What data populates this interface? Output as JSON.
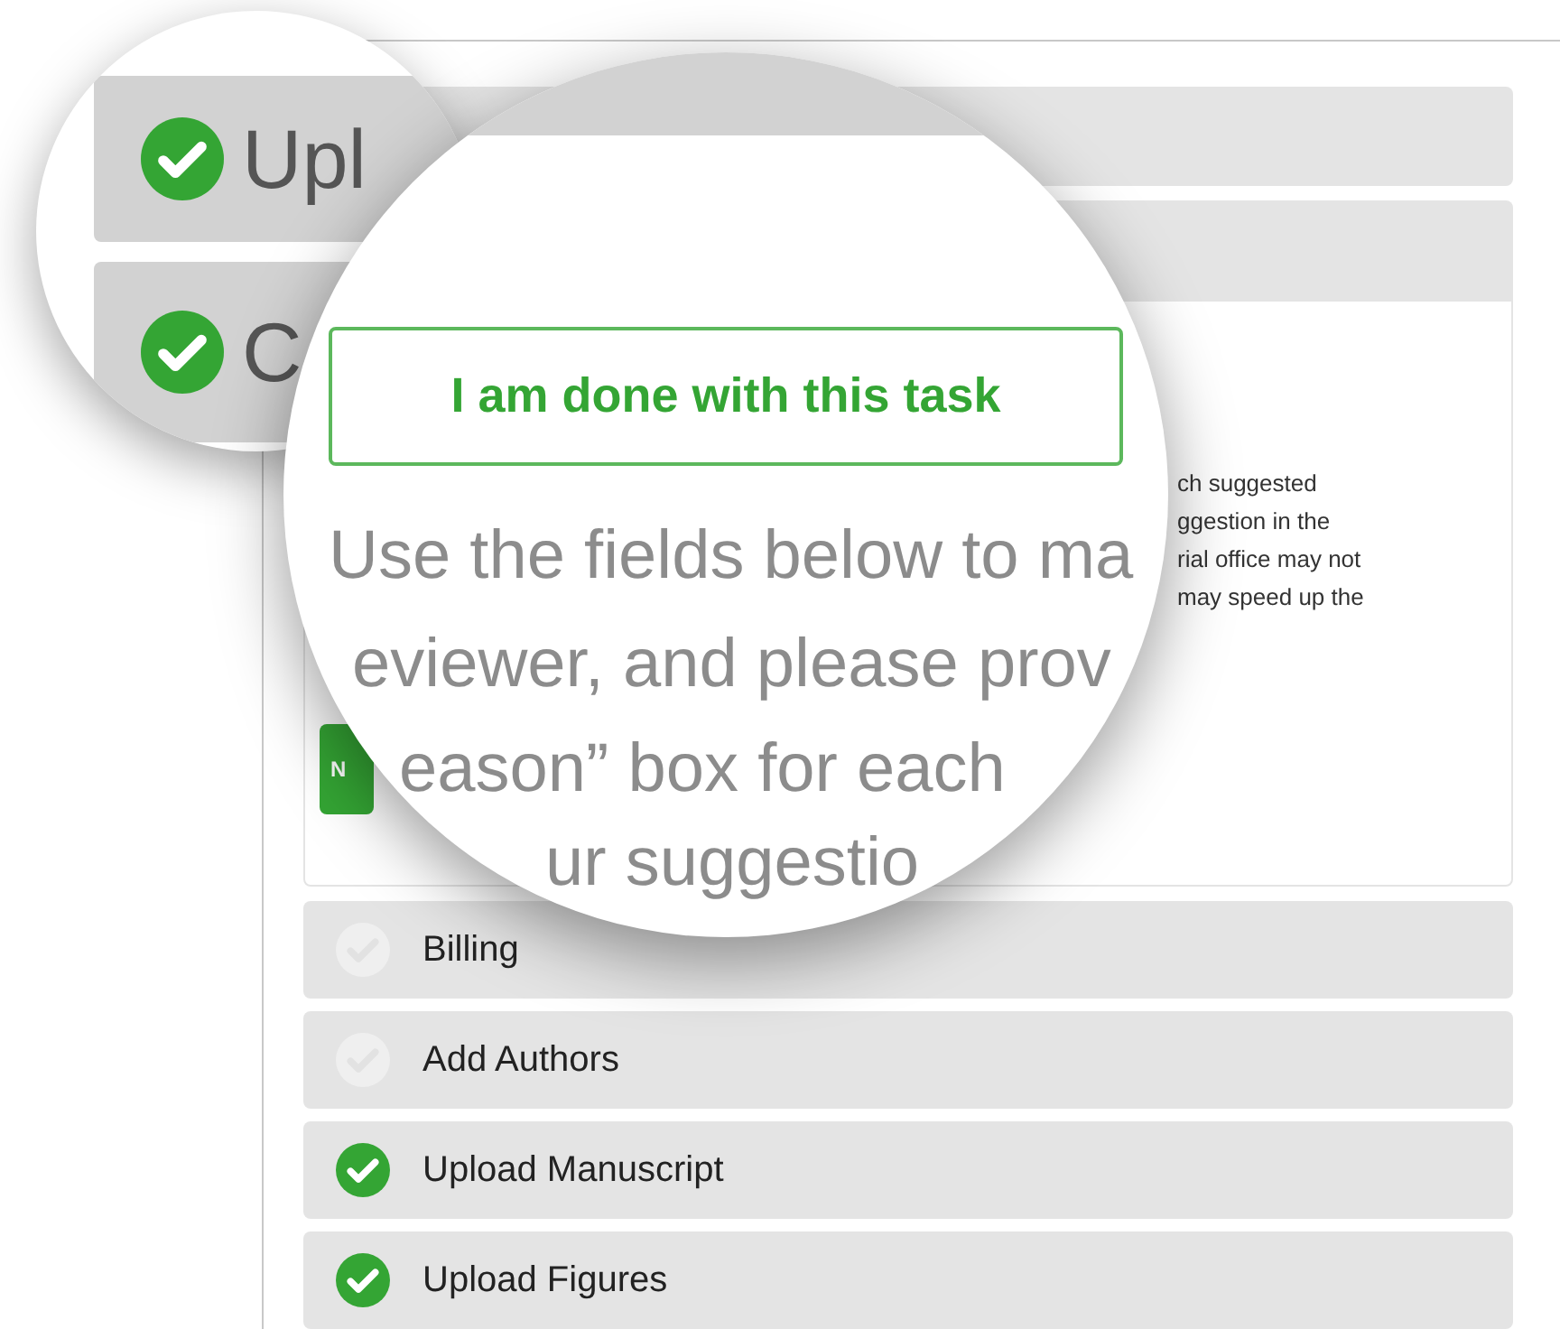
{
  "zoom_small": {
    "rows": [
      {
        "label": "Upl",
        "checked": true
      },
      {
        "label": "C",
        "checked": true
      }
    ]
  },
  "zoom_large": {
    "button": "I am done with this task",
    "text_lines": [
      "Use the fields below to ma",
      "eviewer, and please prov",
      "eason” box for each",
      "ur suggestio"
    ]
  },
  "panel": {
    "body_lines": [
      "ch suggested",
      "ggestion in the",
      "rial office may not",
      "may speed up the"
    ],
    "body_button": "N",
    "tasks": [
      {
        "label": "Billing",
        "checked": false
      },
      {
        "label": "Add Authors",
        "checked": false
      },
      {
        "label": "Upload Manuscript",
        "checked": true
      },
      {
        "label": "Upload Figures",
        "checked": true
      }
    ]
  }
}
